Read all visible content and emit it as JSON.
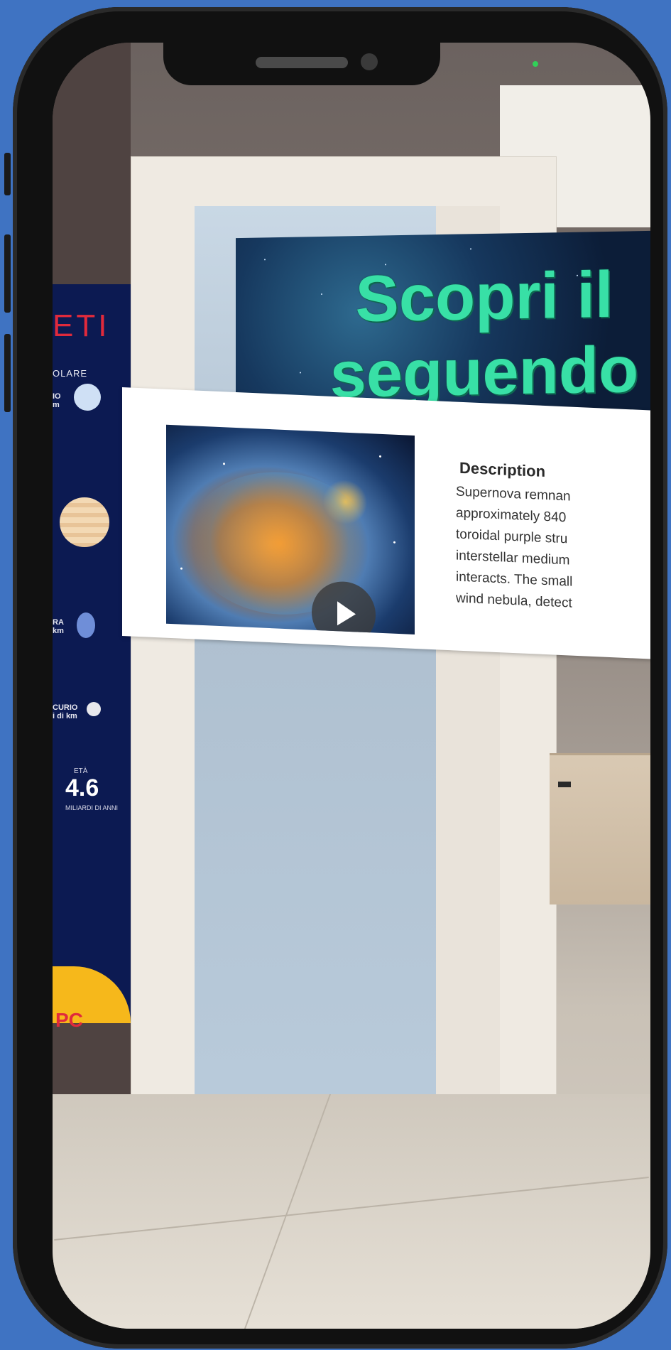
{
  "poster": {
    "title": "ETI",
    "subtitle": "OLARE",
    "planet_label_1": "IO",
    "planet_unit_1": "m",
    "planet_label_2": "RA",
    "planet_unit_2": "km",
    "planet_label_3": "CURIO",
    "planet_unit_3": "i di km",
    "eta_label": "ETÀ",
    "eta_value": "4.6",
    "eta_unit": "MILIARDI DI ANNI",
    "sun_text": "PC"
  },
  "banner": {
    "title_line1": "Scopri il",
    "title_line2": "seguendo"
  },
  "card": {
    "image_icon": "nebula-image",
    "play_icon": "play-icon",
    "description_title": "Description",
    "description_lines": [
      "Supernova remnan",
      "approximately 840",
      "toroidal purple stru",
      "interstellar medium",
      "interacts. The small",
      "wind nebula, detect"
    ]
  },
  "colors": {
    "background": "#3f73c2",
    "banner_text": "#38e0a6",
    "poster_title": "#e02a3c",
    "poster_bg": "#0c1a52"
  }
}
